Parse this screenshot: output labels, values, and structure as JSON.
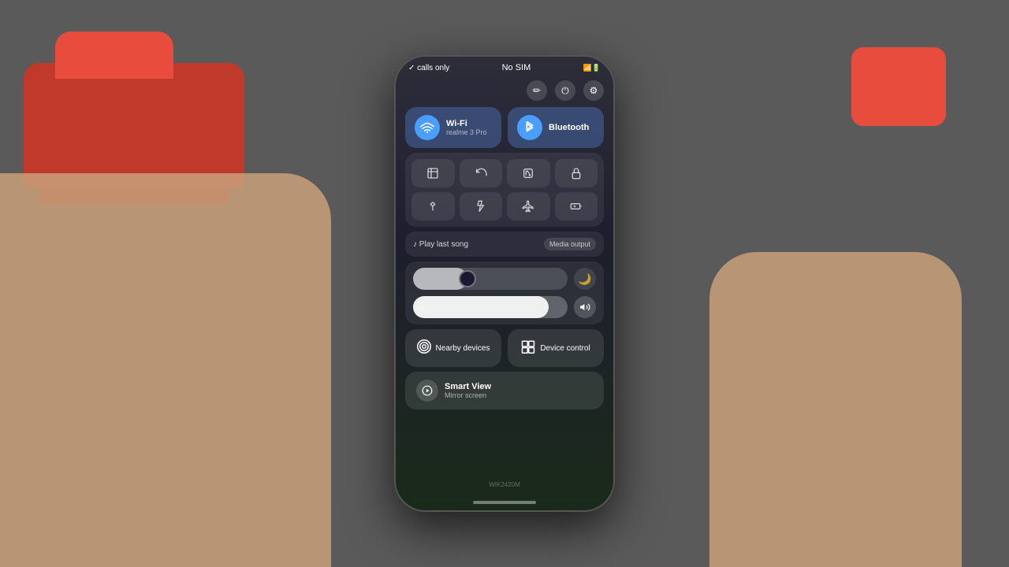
{
  "background": {
    "color": "#5a5a5a"
  },
  "statusBar": {
    "left": "✓ calls only",
    "center": "No SIM",
    "right": "📶🔋"
  },
  "toolbar": {
    "editIcon": "✏",
    "powerIcon": "⏻",
    "settingsIcon": "⚙"
  },
  "toggles": {
    "wifi": {
      "icon": "📶",
      "name": "Wi-Fi",
      "sub": "realme 3 Pro",
      "active": true
    },
    "bluetooth": {
      "icon": "⬡",
      "name": "Bluetooth",
      "sub": "",
      "active": true
    }
  },
  "quickActions": [
    {
      "icon": "⊡",
      "label": "Screenshot",
      "active": false
    },
    {
      "icon": "↻",
      "label": "Auto rotate",
      "active": false
    },
    {
      "icon": "N",
      "label": "NFC",
      "active": false
    },
    {
      "icon": "🔒",
      "label": "Lock",
      "active": false
    },
    {
      "icon": "⇅",
      "label": "Data",
      "active": false
    },
    {
      "icon": "🔦",
      "label": "Flashlight",
      "active": false
    },
    {
      "icon": "✈",
      "label": "Airplane",
      "active": false
    },
    {
      "icon": "🔋",
      "label": "Battery saver",
      "active": false
    }
  ],
  "media": {
    "playLabel": "♪ Play last song",
    "mediaOutputLabel": "Media output"
  },
  "brightness": {
    "value": 35,
    "moonLabel": "🌙"
  },
  "volume": {
    "value": 90,
    "icon": "🔊"
  },
  "bottomButtons": [
    {
      "icon": "◎",
      "name": "Nearby devices",
      "sub": ""
    },
    {
      "icon": "⊞",
      "name": "Device control",
      "sub": ""
    }
  ],
  "smartView": {
    "icon": "▶",
    "name": "Smart View",
    "sub": "Mirror screen"
  },
  "deviceLabel": "WIK2420M"
}
